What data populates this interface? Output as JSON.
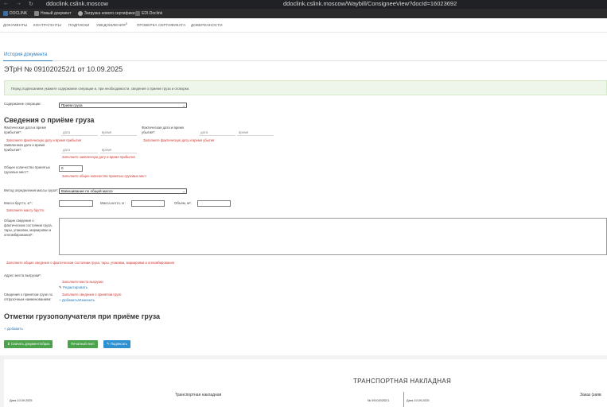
{
  "browser": {
    "nav_back": "←",
    "nav_forward": "→",
    "nav_reload": "↻",
    "url_left": "ddoclink.cslink.moscow",
    "url_full": "ddoclink.cslink.moscow/Waybill/ConsigneeView?docId=16023692"
  },
  "bookmarks": [
    {
      "label": "DOCLINK",
      "color": "#3a6ea5"
    },
    {
      "label": "Новый документ",
      "color": "#555555"
    },
    {
      "label": "Загрузка нового сертификата",
      "color": "#777777"
    },
    {
      "label": "EDI.Doclink",
      "color": "#444444"
    }
  ],
  "nav": {
    "items": [
      "ДОКУМЕНТЫ",
      "КОНТРАГЕНТЫ",
      "ПОДПИСКИ",
      "УВЕДОМЛЕНИЯ",
      "ПРОВЕРКА СЕРТИФИКАТА",
      "ДОВЕРЕННОСТИ"
    ],
    "badge": "0"
  },
  "history_link": "История документа",
  "doc": {
    "title": "ЭТрН №   091020252/1  от   10.09.2025"
  },
  "alert": "Перед подписанием укажите содержание операции и, при необходимости, сведения о приеме груза и оговорки.",
  "operation": {
    "label": "Содержание операции:",
    "value": "Прием груза"
  },
  "section_receipt": {
    "title": "Сведения о приёме груза",
    "actual_arrival_label": "Фактическая дата и время прибытия*:",
    "actual_departure_label": "Фактическая дата и время убытия*:",
    "planned_arrival_label": "Заявленная дата и время прибытия*:",
    "date_placeholder": "дата",
    "time_placeholder": "время",
    "err_actual_arrival": "Заполните фактическую дату и время прибытия",
    "err_actual_departure": "Заполните фактическую дату и время убытия",
    "err_planned_arrival": "Заполните заявленную дату и время прибытия",
    "places_label": "Общее количество принятых грузовых мест*:",
    "places_value": "0",
    "err_places": "Заполните общее количество принятых грузовых мест",
    "weight_method_label": "Метод определения массы груза*:",
    "weight_method_value": "Взвешивание по общей массе",
    "gross_label": "Масса брутто, кг*:",
    "net_label": "Масса нетто, кг:",
    "volume_label": "Объём, м³:",
    "err_gross": "Заполните массу брутто",
    "general_label": "Общие сведения о фактическом состоянии груза, тары, упаковки, маркировки и опломбирования*:",
    "err_general": "Заполните общие сведения о фактическом состоянии груза, тары, упаковки, маркировки и опломбирования",
    "unload_label": "Адрес места выгрузки*:",
    "err_unload": "Заполните места выгрузки",
    "edit_link": "Редактировать",
    "accepted_label": "Сведения о принятом грузе по отгрузочным наименованиям:",
    "err_accepted": "Заполните сведения о принятом грузе",
    "add_edit_link": "Добавить/Изменить"
  },
  "section_marks": {
    "title": "Отметки грузополучателя при приёме груза",
    "add_link": "Добавить"
  },
  "buttons": {
    "download": "Скачать документ/образ",
    "print": "Печатный лист",
    "sign": "Подписать"
  },
  "preview": {
    "big_title": "ТРАНСПОРТНАЯ НАКЛАДНАЯ",
    "sub_title": "Транспортная накладная",
    "date_left": "Дата  10.09.2025",
    "number": "№   091020252/1",
    "date_right": "Дата  10.09.2025",
    "order": "Заказ (заяв"
  }
}
